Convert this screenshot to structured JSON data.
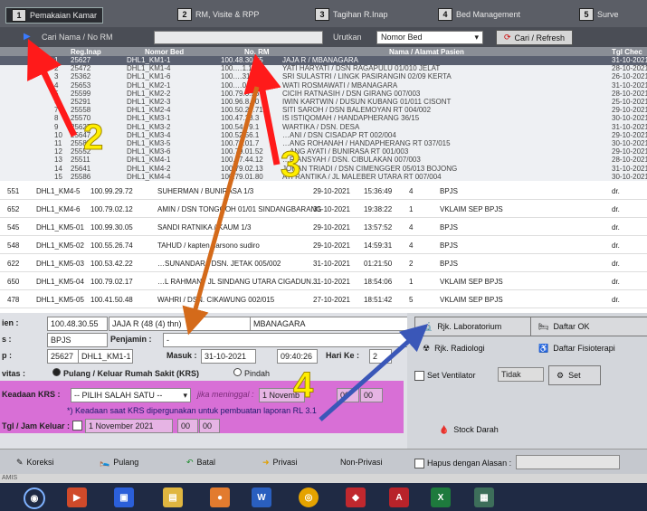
{
  "tabs": [
    {
      "num": "1",
      "label": "Pemakaian Kamar"
    },
    {
      "num": "2",
      "label": "RM, Visite & RPP"
    },
    {
      "num": "3",
      "label": "Tagihan R.Inap"
    },
    {
      "num": "4",
      "label": "Bed Management"
    },
    {
      "num": "5",
      "label": "Surve"
    }
  ],
  "search": {
    "label": "Cari Nama / No RM",
    "urutkan_label": "Urutkan",
    "sort_value": "Nomor Bed",
    "refresh_label": "Cari / Refresh"
  },
  "grid_top": {
    "headers": [
      "Reg.Inap",
      "Nomor Bed",
      "No. RM",
      "Nama / Alamat Pasien",
      "Tgl Chec"
    ],
    "rows": [
      [
        "25627",
        "DHL1_KM1-1",
        "100.48.30.55",
        "JAJA R / MBANAGARA",
        "31-10-2021"
      ],
      [
        "25472",
        "DHL1_KM1-4",
        "100.…1.14",
        "YATI HARYATI / DSN RAGAPULU 01/010 JELAT",
        "28-10-2021"
      ],
      [
        "25362",
        "DHL1_KM1-6",
        "100.…31",
        "SRI SULASTRI / LINGK PASIRANGIN 02/09 KERTA",
        "26-10-2021"
      ],
      [
        "25653",
        "DHL1_KM2-1",
        "100.…0",
        "WATI ROSMAWATI / MBANAGARA",
        "31-10-2021"
      ],
      [
        "25599",
        "DHL1_KM2-2",
        "100.79.0.56",
        "CICIH RATNASIH / DSN GIRANG 007/003",
        "28-10-2021"
      ],
      [
        "25291",
        "DHL1_KM2-3",
        "100.96.8.20",
        "IWIN KARTWIN / DUSUN KUBANG 01/011 CISONT",
        "25-10-2021"
      ],
      [
        "25558",
        "DHL1_KM2-4",
        "100.50.26.71",
        "SITI SAROH / DSN BALEMOYAN RT 004/002",
        "29-10-2021"
      ],
      [
        "25570",
        "DHL1_KM3-1",
        "100.47.28.3",
        "IS ISTIQOMAH / HANDAPHERANG 36/15",
        "30-10-2021"
      ],
      [
        "25627",
        "DHL1_KM3-2",
        "100.54.79.1",
        "WARTIKA / DSN. DESA",
        "31-10-2021"
      ],
      [
        "25647",
        "DHL1_KM3-4",
        "100.52.56.1",
        "…ANI / DSN CISADAP RT 002/004",
        "29-10-2021"
      ],
      [
        "25585",
        "DHL1_KM3-5",
        "100.79.01.7",
        "…ANG ROHANAH / HANDAPHERANG RT 037/015",
        "30-10-2021"
      ],
      [
        "25552",
        "DHL1_KM3-6",
        "100.79.01.52",
        "…ANG AYATI / BUNIRASA RT 001/003",
        "29-10-2021"
      ],
      [
        "25511",
        "DHL1_KM4-1",
        "100.47.44.12",
        "…RIANSYAH / DSN. CIBULAKAN 007/003",
        "28-10-2021"
      ],
      [
        "25641",
        "DHL1_KM4-2",
        "100.79.02.13",
        "JOHAN TRIADI / DSN CIMENGGER 05/013 BOJONG",
        "31-10-2021"
      ],
      [
        "25586",
        "DHL1_KM4-4",
        "100.79.01.80",
        "ATI RANTIKA / JL MALEBER UTARA RT 007/004",
        "30-10-2021"
      ]
    ]
  },
  "grid_bottom": {
    "rows": [
      [
        "551",
        "DHL1_KM4-5",
        "100.99.29.72",
        "SUHERMAN / BUNIRASA 1/3",
        "29-10-2021",
        "15:36:49",
        "4",
        "BPJS",
        "",
        "dr."
      ],
      [
        "652",
        "DHL1_KM4-6",
        "100.79.02.12",
        "AMIN / DSN TONGGOH 01/01 SINDANGBARANG",
        "31-10-2021",
        "19:38:22",
        "1",
        "VKLAIM SEP BPJS",
        "",
        "dr."
      ],
      [
        "545",
        "DHL1_KM5-01",
        "100.99.30.05",
        "SANDI RATNIKA / KAUM 1/3",
        "29-10-2021",
        "13:57:52",
        "4",
        "BPJS",
        "",
        "dr."
      ],
      [
        "548",
        "DHL1_KM5-02",
        "100.55.26.74",
        "TAHUD / kapten harsono sudiro",
        "29-10-2021",
        "14:59:31",
        "4",
        "BPJS",
        "",
        "dr."
      ],
      [
        "622",
        "DHL1_KM5-03",
        "100.53.42.22",
        "…SUNANDAR / DSN. JETAK 005/002",
        "31-10-2021",
        "01:21:50",
        "2",
        "BPJS",
        "",
        "dr."
      ],
      [
        "650",
        "DHL1_KM5-04",
        "100.79.02.17",
        "…L RAHMAN / JL SINDANG UTARA CIGADUN…",
        "31-10-2021",
        "18:54:06",
        "1",
        "VKLAIM SEP BPJS",
        "",
        "dr."
      ],
      [
        "478",
        "DHL1_KM5-05",
        "100.41.50.48",
        "WAHRI / DSN. CIKAWUNG 002/015",
        "27-10-2021",
        "18:51:42",
        "5",
        "VKLAIM SEP BPJS",
        "",
        "dr."
      ]
    ]
  },
  "form": {
    "pasien_label": "ien :",
    "no_rm": "100.48.30.55",
    "nama": "JAJA R (48 (4) thn)",
    "alamat": "MBANAGARA",
    "jenis_label": "s :",
    "jenis": "BPJS",
    "penjamin_label": "Penjamin :",
    "penjamin": "-",
    "kamar_label": "p :",
    "reg": "25627",
    "bed": "DHL1_KM1-1",
    "masuk_label": "Masuk :",
    "masuk_tgl": "31-10-2021",
    "masuk_jam": "09:40:26",
    "hari_label": "Hari Ke :",
    "hari": "2",
    "aktivitas_label": "vitas :",
    "opt_pulang": "Pulang / Keluar Rumah Sakit (KRS)",
    "opt_pindah": "Pindah",
    "keadaan_label": "Keadaan KRS :",
    "keadaan_value": "-- PILIH SALAH SATU --",
    "meninggal_label": "jika meninggal :",
    "meninggal_tgl": "1 Novemb",
    "meninggal_h": "00",
    "meninggal_m": "00",
    "note": "*) Keadaan saat KRS dipergunakan untuk pembuatan laporan RL 3.1",
    "tgl_keluar_label": "Tgl / Jam Keluar :",
    "tgl_keluar": "1 November 2021",
    "jam_keluar_h": "00",
    "jam_keluar_m": "00"
  },
  "right": {
    "lab": "Rjk. Laboratorium",
    "ok": "Daftar OK",
    "rad": "Rjk. Radiologi",
    "fisio": "Daftar Fisioterapi",
    "ventilator": "Set Ventilator",
    "tidak": "Tidak",
    "set": "Set",
    "stock": "Stock Darah"
  },
  "bottom": {
    "koreksi": "Koreksi",
    "pulang": "Pulang",
    "batal": "Batal",
    "privasi": "Privasi",
    "nonprivasi": "Non-Privasi",
    "hapus": "Hapus dengan Alasan :",
    "status": "AMIS"
  },
  "annotations": [
    "2",
    "3",
    "4"
  ]
}
